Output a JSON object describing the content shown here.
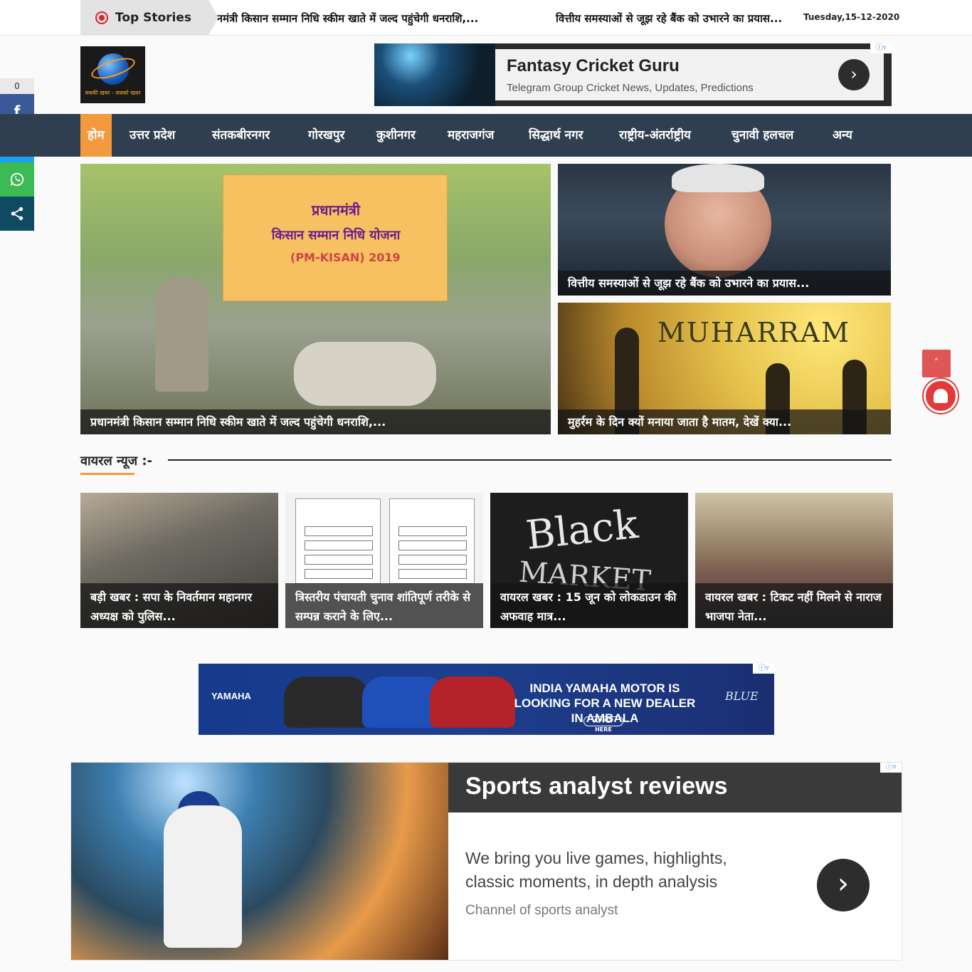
{
  "topbar": {
    "label": "Top Stories",
    "ticker": [
      "प्रधानमंत्री किसान सम्मान निधि स्कीम खाते में जल्द पहुंचेगी धनराशि,...",
      "वित्तीय समस्याओं से जूझ रहे बैंक को उभारने का प्रयास..."
    ],
    "date": "Tuesday,15-12-2020"
  },
  "social": {
    "count": "0",
    "buttons": [
      {
        "icon": "facebook-icon",
        "glyph": "f",
        "color": "#3b5998"
      },
      {
        "icon": "twitter-icon",
        "glyph": "t",
        "color": "#1da1f2"
      },
      {
        "icon": "whatsapp-icon",
        "glyph": "w",
        "color": "#3cba54"
      },
      {
        "icon": "share-icon",
        "glyph": "<",
        "color": "#0f4a63"
      }
    ]
  },
  "logo": {
    "tagline": "सबकी खबर - सबको खबर"
  },
  "ad_top": {
    "title": "Fantasy Cricket Guru",
    "subtitle": "Telegram Group Cricket News, Updates, Predictions",
    "arrow": "›"
  },
  "nav": {
    "items": [
      "होम",
      "उत्तर प्रदेश",
      "संतकबीरनगर",
      "गोरखपुर",
      "कुशीनगर",
      "महराजगंज",
      "सिद्धार्थ नगर",
      "राष्ट्रीय-अंतर्राष्ट्रीय",
      "चुनावी हलचल",
      "अन्य"
    ]
  },
  "featured": {
    "main": {
      "caption": "प्रधानमंत्री किसान सम्मान निधि स्कीम खाते में जल्द पहुंचेगी धनराशि,...",
      "board_l1": "प्रधानमंत्री",
      "board_l2": "किसान सम्मान निधि योजना",
      "board_l3": "(PM-KISAN) 2019"
    },
    "right_top": {
      "caption": "वित्तीय समस्याओं से जूझ रहे बैंक को उभारने का प्रयास..."
    },
    "right_bottom": {
      "caption": "मुहर्रम के दिन क्यों मनाया जाता है मातम, देखें क्या...",
      "image_text": "MUHARRAM"
    }
  },
  "viral": {
    "title": "वायरल न्यूज :-",
    "items": [
      {
        "caption": "बड़ी खबर : सपा के निवर्तमान महानगर अध्यक्ष को पुलिस..."
      },
      {
        "caption": "त्रिस्तरीय पंचायती चुनाव शांतिपूर्ण तरीके से सम्पन्न कराने के लिए..."
      },
      {
        "caption": "वायरल खबर : 15 जून को लोकडाउन की अफवाह मात्र...",
        "image_text_1": "Black",
        "image_text_2": "MARKET"
      },
      {
        "caption": "वायरल खबर : टिकट नहीं मिलने से नाराज भाजपा नेता..."
      }
    ]
  },
  "ad_mid": {
    "brand": "YAMAHA",
    "headline": "INDIA YAMAHA MOTOR IS LOOKING FOR A NEW DEALER IN AMBALA",
    "cta": "APPLY HERE",
    "slogan": "BLUE"
  },
  "ad_big": {
    "title": "Sports analyst reviews",
    "description": "We bring you live games, highlights, classic moments, in depth analysis",
    "channel": "Channel of sports analyst",
    "arrow": "›"
  },
  "adchoice": "ⓘ▿",
  "scroll_top": "˄"
}
